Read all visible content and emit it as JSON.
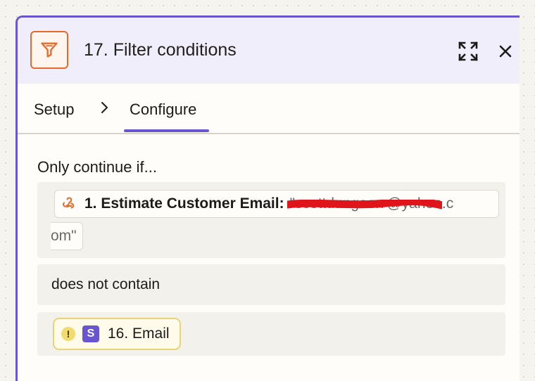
{
  "header": {
    "title": "17. Filter conditions",
    "app_icon": "filter-icon",
    "expand_icon": "expand-icon",
    "close_icon": "close-icon",
    "accent_color": "#e86a2a"
  },
  "tabs": [
    {
      "label": "Setup",
      "active": false
    },
    {
      "label": "Configure",
      "active": true
    }
  ],
  "tab_accent": "#6a55d1",
  "filter": {
    "heading": "Only continue if...",
    "field": {
      "icon": "webhook-icon",
      "label": "1. Estimate Customer Email:",
      "value_line1": "\"scottdungeon @yahoo.c",
      "value_line2": "om\""
    },
    "condition": "does not contain",
    "compare": {
      "warning_icon": "warning-icon",
      "app_badge": "S",
      "label": "16. Email"
    }
  }
}
